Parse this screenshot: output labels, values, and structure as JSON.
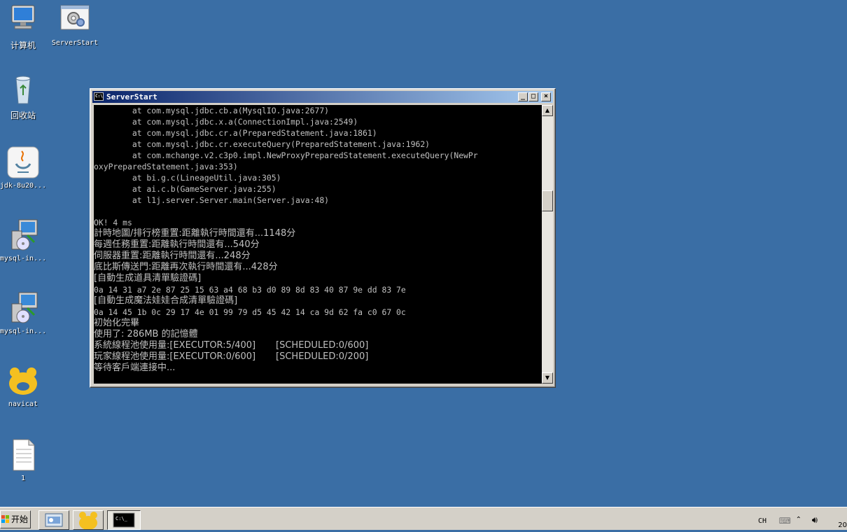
{
  "desktop": {
    "icons": [
      {
        "label": "计算机"
      },
      {
        "label": "ServerStart"
      },
      {
        "label": "回收站"
      },
      {
        "label": "jdk-8u20..."
      },
      {
        "label": "mysql-in..."
      },
      {
        "label": "mysql-in..."
      },
      {
        "label": "navicat"
      },
      {
        "label": "1"
      }
    ]
  },
  "window": {
    "title": "ServerStart",
    "minimize_glyph": "_",
    "maximize_glyph": "□",
    "close_glyph": "×",
    "console_lines": [
      "        at com.mysql.jdbc.cb.a(MysqlIO.java:2677)",
      "        at com.mysql.jdbc.x.a(ConnectionImpl.java:2549)",
      "        at com.mysql.jdbc.cr.a(PreparedStatement.java:1861)",
      "        at com.mysql.jdbc.cr.executeQuery(PreparedStatement.java:1962)",
      "        at com.mchange.v2.c3p0.impl.NewProxyPreparedStatement.executeQuery(NewPr",
      "oxyPreparedStatement.java:353)",
      "        at bi.g.c(LineageUtil.java:305)",
      "        at ai.c.b(GameServer.java:255)",
      "        at l1j.server.Server.main(Server.java:48)",
      "",
      "OK! 4 ms",
      "計時地圖/排行榜重置:距離執行時間還有...1148分",
      "每週任務重置:距離執行時間還有...540分",
      "伺服器重置:距離執行時間還有...248分",
      "底比斯傳送門:距離再次執行時間還有...428分",
      "[自動生成道具清單驗證碼]",
      "0a 14 31 a7 2e 87 25 15 63 a4 68 b3 d0 89 8d 83 40 87 9e dd 83 7e",
      "[自動生成魔法娃娃合成清單驗證碼]",
      "0a 14 45 1b 0c 29 17 4e 01 99 79 d5 45 42 14 ca 9d 62 fa c0 67 0c",
      "初始化完畢",
      "使用了: 286MB 的記憶體",
      "系統線程池使用量:[EXECUTOR:5/400]       [SCHEDULED:0/600]",
      "玩家線程池使用量:[EXECUTOR:0/600]       [SCHEDULED:0/200]",
      "等待客戶端連接中..."
    ]
  },
  "taskbar": {
    "start_label": "开始",
    "console_icon_text": "C:\\_",
    "language": "CH",
    "clock_partial": "20"
  },
  "colors": {
    "desktop": "#3a6ea5",
    "console_bg": "#000000",
    "console_fg": "#c0c0c0",
    "title_gradient_start": "#0a246a",
    "title_gradient_end": "#a6caf0"
  }
}
